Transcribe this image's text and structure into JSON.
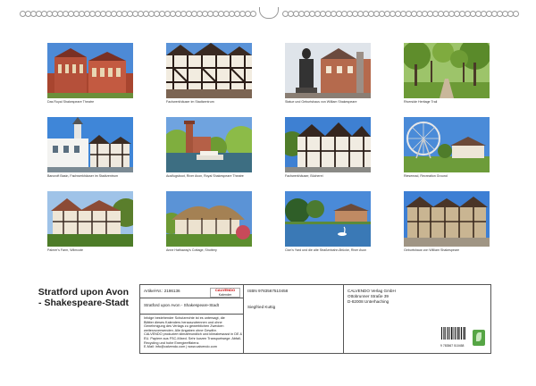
{
  "photos": [
    {
      "caption": "Das Royal Shakespeare Theatre",
      "icon": "theatre-building"
    },
    {
      "caption": "Fachwerkhäuser im Stadtzentrum",
      "icon": "timber-houses"
    },
    {
      "caption": "Statue und Geburtshaus von William Shakespeare",
      "icon": "statue"
    },
    {
      "caption": "Riverside Heritage Trail",
      "icon": "tree-avenue"
    },
    {
      "caption": "Bancroft Basin, Fachwerkhäuser im Stadtzentrum",
      "icon": "basin-houses"
    },
    {
      "caption": "Ausflugsboot, River Avon, Royal Shakespeare Theatre",
      "icon": "boat-river"
    },
    {
      "caption": "Fachwerkhäuser, Bücherei",
      "icon": "timber-library"
    },
    {
      "caption": "Riesenrad, Recreation Ground",
      "icon": "ferris-wheel"
    },
    {
      "caption": "Palmer's Farm, Wilmcote",
      "icon": "farmhouse"
    },
    {
      "caption": "Anne Hathaway's Cottage, Shottery",
      "icon": "thatched-cottage"
    },
    {
      "caption": "Clon's Yard und die alte Straßenbahn-Brücke, River Avon",
      "icon": "river-swan"
    },
    {
      "caption": "Geburtshaus von William Shakespeare",
      "icon": "birthplace"
    }
  ],
  "cover_title": "Stratford upon Avon - Shakespeare-Stadt",
  "info": {
    "article": "Artikel-Nr.: 2186136",
    "logo_brand": "CALVENDO",
    "logo_tag": "Kalender",
    "calendar_title": "Stratford upon Avon - Shakespeare-Stadt",
    "legal_text": [
      "Infolge bestehender Schutzrechte ist es untersagt, die",
      "Blätter dieses Kalenders herauszutrennen und ohne",
      "Genehmigung des Verlags zu gewerblichen Zwecken",
      "weiterzuverwenden. Alle Angaben ohne Gewähr.",
      "CALVENDO produziert klimafreundlich und klimabewusst in DE &",
      "EU. Papiere aus FSC-Mixed. Sehr kurzen Transportwege. Abfall-",
      "Recycling und hohe Energieeffizienz.",
      "E-Mail: info@calvendo.com | www.calvendo.com"
    ],
    "isbn": "ISBN 9783567510458",
    "author": "Siegfried Kuttig",
    "publisher": [
      "CALVENDO Verlag GmbH",
      "Ottobrunner Straße 39",
      "D-82008 Unterhaching"
    ],
    "barcode_number": "9 783567 510458",
    "colors": {
      "eco": "#56a545",
      "logo_red": "#cc0000"
    }
  }
}
